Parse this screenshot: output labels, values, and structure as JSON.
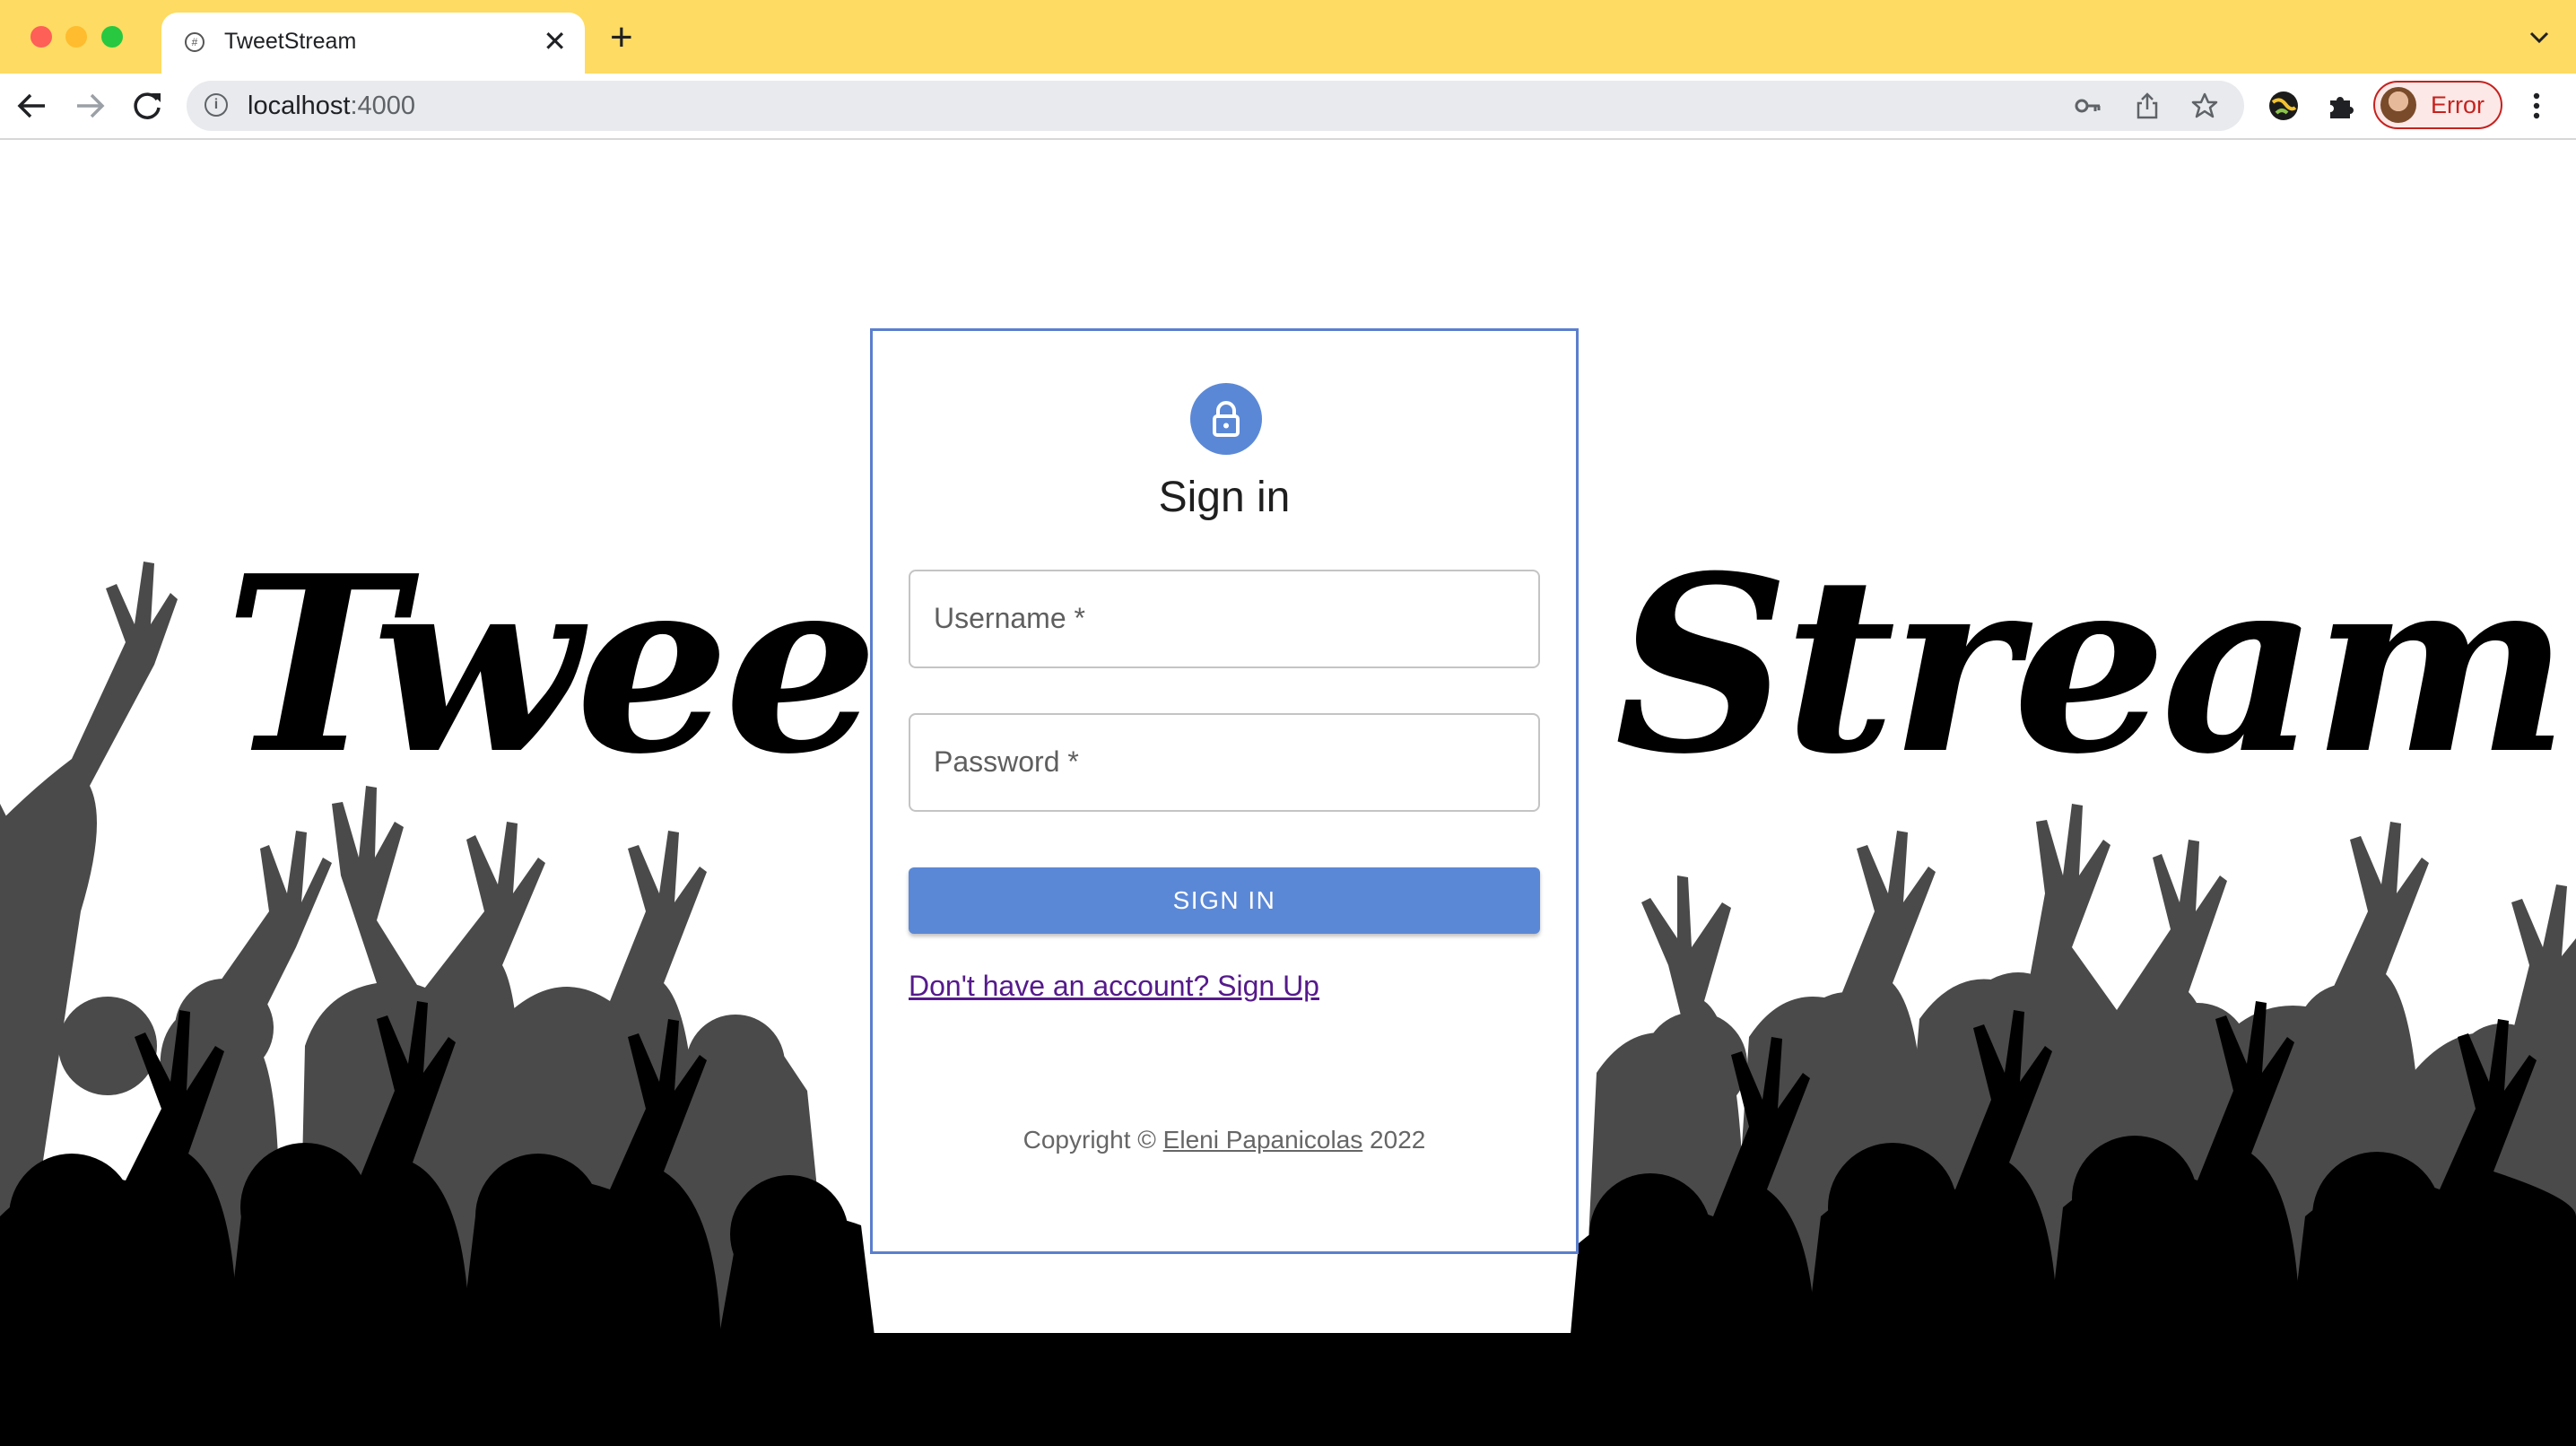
{
  "browser": {
    "tab_title": "TweetStream",
    "url_host": "localhost",
    "url_port": ":4000",
    "profile_label": "Error",
    "colors": {
      "tabbar": "#fedb62",
      "profile_error": "#c5221f"
    }
  },
  "hero": {
    "left_word": "Tweet",
    "right_word": "Stream"
  },
  "signin": {
    "title": "Sign in",
    "username_label": "Username *",
    "password_label": "Password *",
    "submit_label": "SIGN IN",
    "signup_link": "Don't have an account? Sign Up",
    "copyright_prefix": "Copyright © ",
    "copyright_author": "Eleni Papanicolas",
    "copyright_year": " 2022",
    "colors": {
      "accent": "#5b88d6",
      "card_border": "#5b7fce",
      "link": "#551a8b"
    },
    "icon": "lock-icon"
  }
}
